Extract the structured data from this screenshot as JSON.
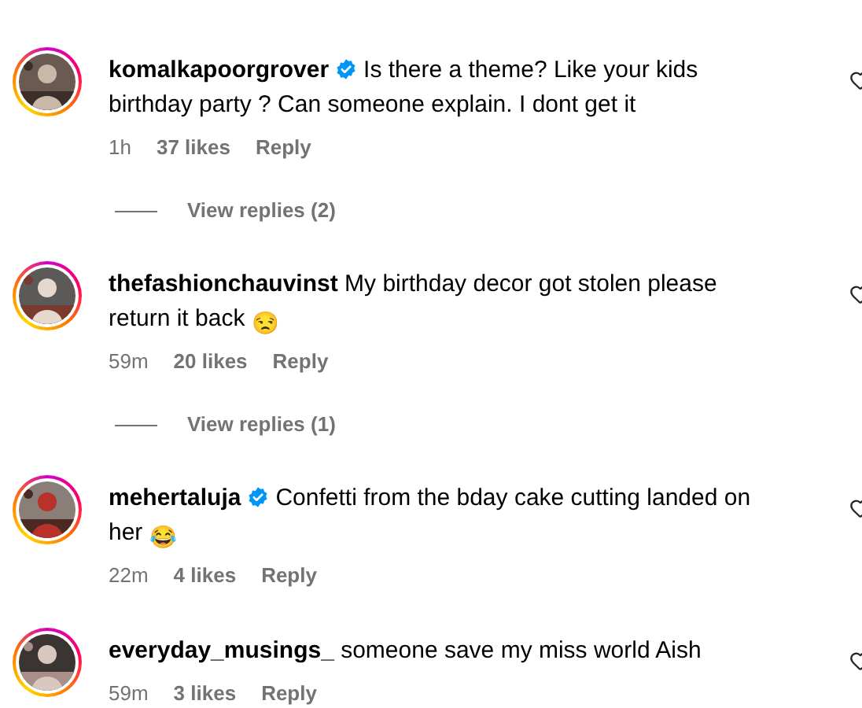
{
  "comments": [
    {
      "username": "komalkapoorgrover",
      "verified": true,
      "text": "Is there a theme? Like your kids birthday party ? Can someone explain. I dont get it",
      "time": "1h",
      "likes": "37 likes",
      "reply": "Reply",
      "view_replies": "View replies (2)"
    },
    {
      "username": "thefashionchauvinst",
      "verified": false,
      "text": "My birthday decor got stolen please return it back 😒",
      "time": "59m",
      "likes": "20 likes",
      "reply": "Reply",
      "view_replies": "View replies (1)"
    },
    {
      "username": "mehertaluja",
      "verified": true,
      "text": "Confetti from the bday cake cutting landed on her 😂",
      "time": "22m",
      "likes": "4 likes",
      "reply": "Reply"
    },
    {
      "username": "everyday_musings_",
      "verified": false,
      "text": "someone save my miss world Aish",
      "time": "59m",
      "likes": "3 likes",
      "reply": "Reply"
    }
  ]
}
